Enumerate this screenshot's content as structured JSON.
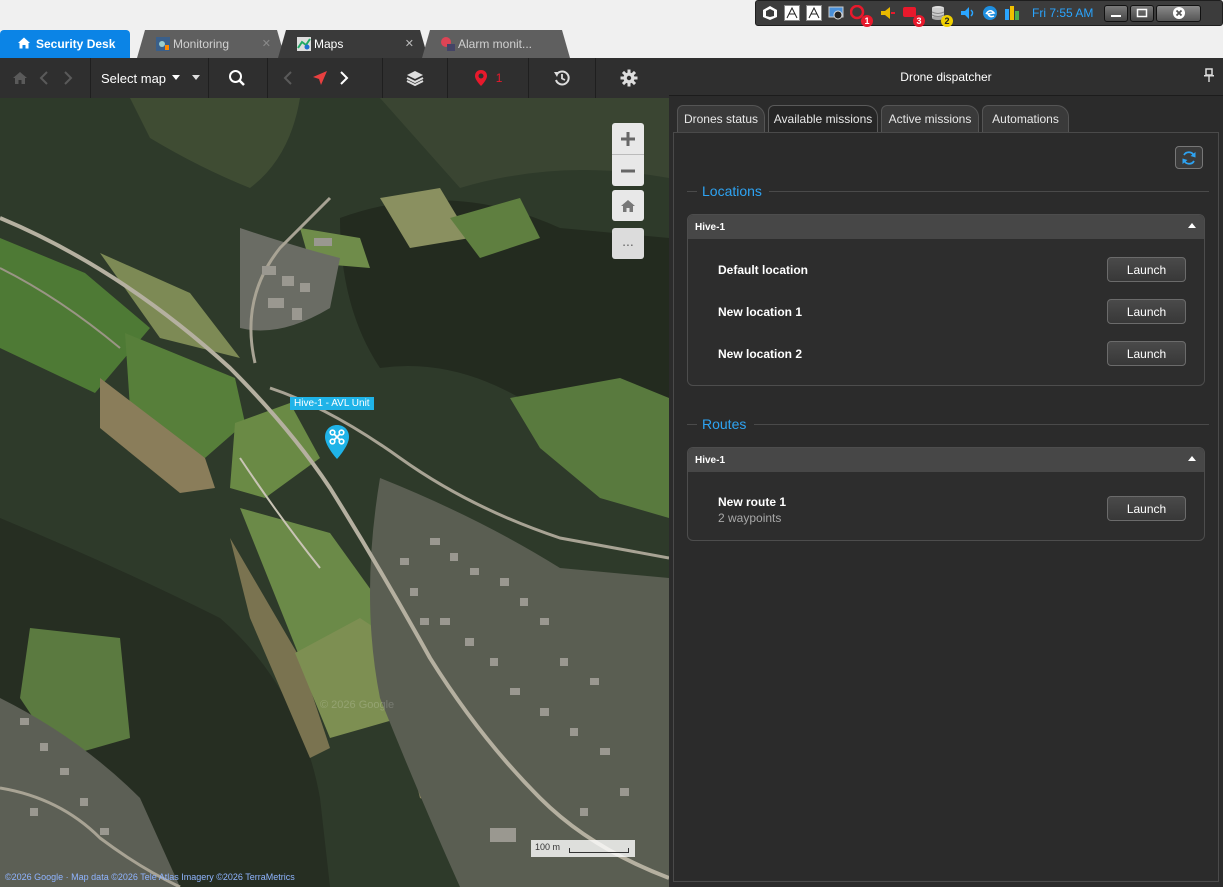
{
  "tray": {
    "time": "Fri 7:55 AM",
    "badges": [
      "1",
      "3",
      "2"
    ],
    "window_buttons": [
      "minimize",
      "maximize",
      "close"
    ]
  },
  "tabs": [
    {
      "label": "Security Desk",
      "icon": "home-icon"
    },
    {
      "label": "Monitoring",
      "icon": "monitoring-icon"
    },
    {
      "label": "Maps",
      "icon": "maps-icon"
    },
    {
      "label": "Alarm monit...",
      "icon": "alarm-icon"
    }
  ],
  "map_toolbar": {
    "select_map": "Select map",
    "alarm_count": "1"
  },
  "map": {
    "unit_label": "Hive-1 - AVL Unit",
    "scale": "100 m",
    "attribution": "©2026 Google · Map data ©2026 Tele Atlas Imagery ©2026 TerraMetrics",
    "watermark": "© 2026 Google",
    "more": "..."
  },
  "panel": {
    "title": "Drone dispatcher",
    "tabs": [
      "Drones status",
      "Available missions",
      "Active missions",
      "Automations"
    ],
    "active_tab": "Available missions",
    "locations": {
      "title": "Locations",
      "group": "Hive-1",
      "items": [
        {
          "label": "Default location",
          "action": "Launch"
        },
        {
          "label": "New location 1",
          "action": "Launch"
        },
        {
          "label": "New location 2",
          "action": "Launch"
        }
      ]
    },
    "routes": {
      "title": "Routes",
      "group": "Hive-1",
      "items": [
        {
          "label": "New route 1",
          "sub": "2 waypoints",
          "action": "Launch"
        }
      ]
    }
  },
  "colors": {
    "accent": "#0b84e6",
    "section_title": "#2ea3f2",
    "unit_label": "#1fb3e8",
    "alert_red": "#e8192c"
  }
}
